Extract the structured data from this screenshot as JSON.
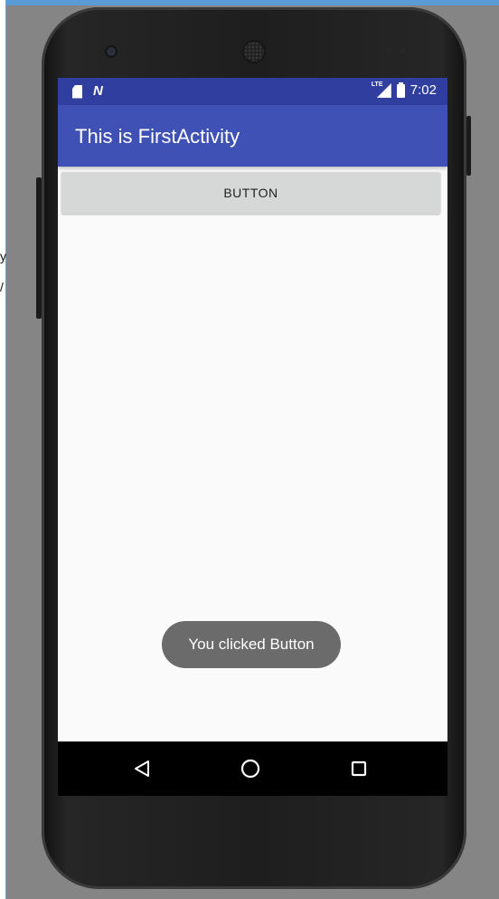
{
  "device": {
    "status_bar": {
      "time": "7:02",
      "network_label": "LTE",
      "icons": [
        "sd-card-icon",
        "n-notification-icon",
        "signal-lte-icon",
        "battery-icon"
      ]
    },
    "nav_bar": {
      "icons": [
        "back-icon",
        "home-icon",
        "recents-icon"
      ]
    },
    "colors": {
      "status_bar": "#303f9f",
      "app_bar": "#3f51b5",
      "button": "#d6d7d7",
      "toast": "#6b6b6b",
      "nav_bar": "#000000"
    }
  },
  "app": {
    "title": "This is FirstActivity",
    "button_label": "BUTTON",
    "toast_text": "You clicked Button"
  }
}
